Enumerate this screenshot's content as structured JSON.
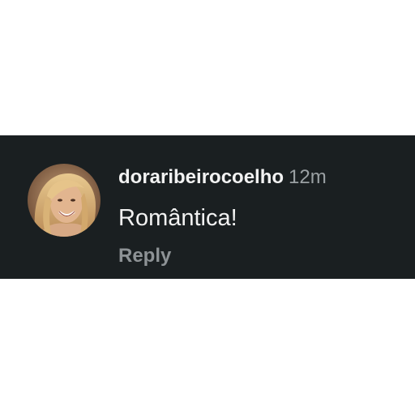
{
  "comment": {
    "username": "doraribeirocoelho",
    "timestamp": "12m",
    "text": "Romântica!",
    "reply_label": "Reply",
    "avatar_icon": "profile-photo-avatar"
  },
  "colors": {
    "card_background": "#1a1f21",
    "primary_text": "#f2f2f2",
    "secondary_text": "#9aa0a3",
    "reply_text": "#8d9295"
  }
}
